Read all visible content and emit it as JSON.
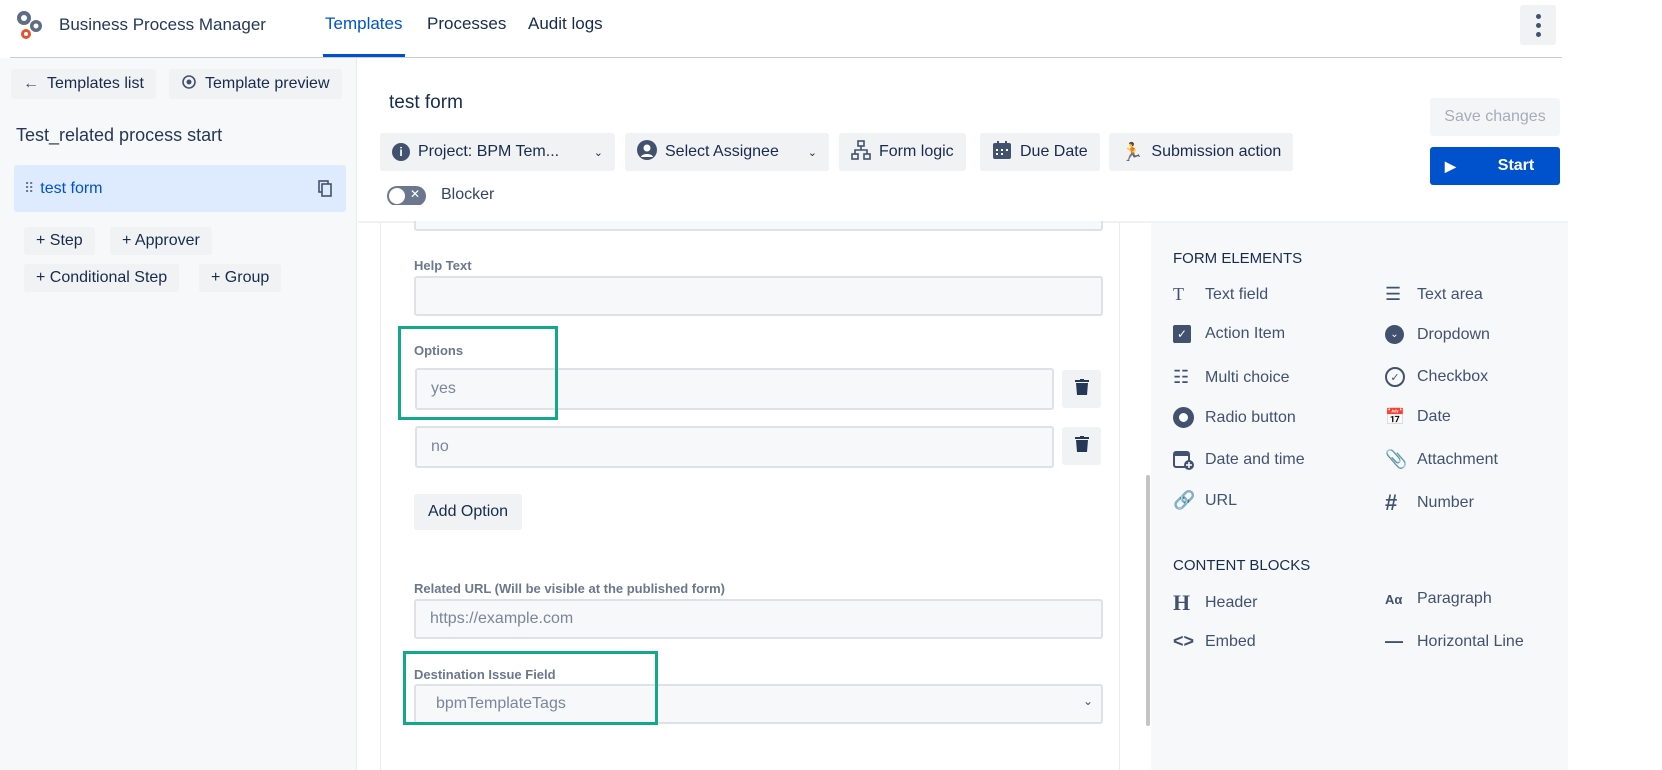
{
  "app": {
    "title": "Business Process Manager",
    "nav": [
      {
        "label": "Templates",
        "active": true
      },
      {
        "label": "Processes"
      },
      {
        "label": "Audit logs"
      }
    ]
  },
  "sidebar": {
    "back_label": "Templates list",
    "preview_label": "Template preview",
    "template_name": "Test_related process start",
    "steps": [
      {
        "label": "test form"
      }
    ],
    "add_buttons": [
      "+ Step",
      "+ Approver",
      "+ Conditional Step",
      "+ Group"
    ]
  },
  "header": {
    "title": "test form",
    "toolbar": {
      "project": "Project: BPM Tem...",
      "assignee": "Select Assignee",
      "form_logic": "Form logic",
      "due_date": "Due Date",
      "submission": "Submission action"
    },
    "blocker_label": "Blocker",
    "blocker_on": false,
    "save_label": "Save changes",
    "start_label": "Start"
  },
  "form": {
    "help_text_label": "Help Text",
    "help_text_value": "",
    "options_label": "Options",
    "options": [
      "yes",
      "no"
    ],
    "add_option_label": "Add Option",
    "related_url_label": "Related URL (Will be visible at the published form)",
    "related_url_placeholder": "https://example.com",
    "destination_label": "Destination Issue Field",
    "destination_value": "bpmTemplateTags"
  },
  "palette": {
    "form_elements_title": "FORM ELEMENTS",
    "form_elements": [
      [
        "Text field",
        "Text area"
      ],
      [
        "Action Item",
        "Dropdown"
      ],
      [
        "Multi choice",
        "Checkbox"
      ],
      [
        "Radio button",
        "Date"
      ],
      [
        "Date and time",
        "Attachment"
      ],
      [
        "URL",
        "Number"
      ]
    ],
    "content_blocks_title": "CONTENT BLOCKS",
    "content_blocks": [
      [
        "Header",
        "Paragraph"
      ],
      [
        "Embed",
        "Horizontal Line"
      ]
    ]
  },
  "colors": {
    "accent": "#0052cc",
    "highlight": "#14a88a",
    "selected_bg": "#deebff"
  }
}
